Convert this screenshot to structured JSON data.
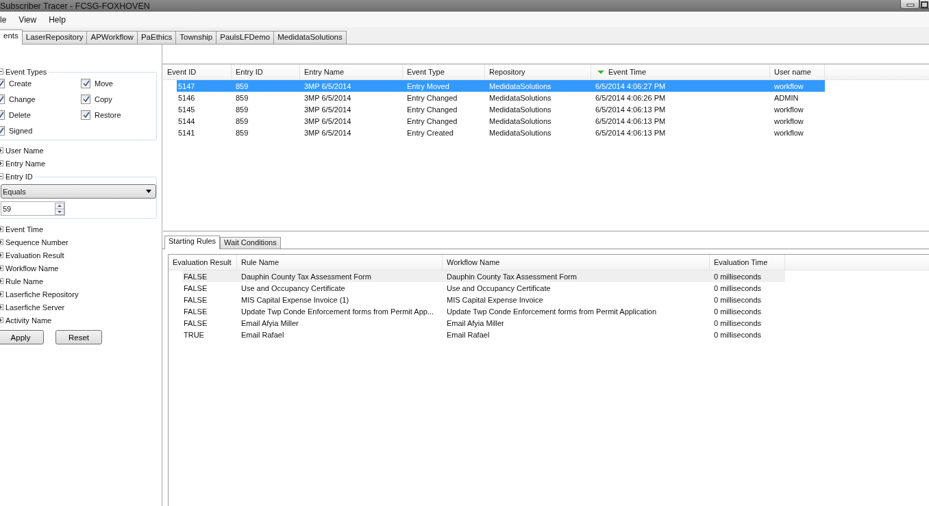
{
  "window": {
    "title": "Subscriber Tracer - FCSG-FOXHOVEN"
  },
  "menu": [
    "le",
    "View",
    "Help"
  ],
  "tabs": [
    {
      "label": "ents",
      "selected": true
    },
    {
      "label": "LaserRepository",
      "selected": false
    },
    {
      "label": "APWorkflow",
      "selected": false
    },
    {
      "label": "PaEthics",
      "selected": false
    },
    {
      "label": "Township",
      "selected": false
    },
    {
      "label": "PaulsLFDemo",
      "selected": false
    },
    {
      "label": "MedidataSolutions",
      "selected": false
    }
  ],
  "filters": [
    {
      "label": "Event Types",
      "expanded": true,
      "kind": "checkboxes",
      "options": [
        {
          "label": "Create",
          "checked": true
        },
        {
          "label": "Move",
          "checked": true
        },
        {
          "label": "Change",
          "checked": true
        },
        {
          "label": "Copy",
          "checked": true
        },
        {
          "label": "Delete",
          "checked": true
        },
        {
          "label": "Restore",
          "checked": true
        },
        {
          "label": "Signed",
          "checked": true
        }
      ]
    },
    {
      "label": "User Name",
      "expanded": false
    },
    {
      "label": "Entry Name",
      "expanded": false
    },
    {
      "label": "Entry ID",
      "expanded": true,
      "kind": "compare",
      "operator": "Equals",
      "value": "59"
    },
    {
      "label": "Event Time",
      "expanded": false
    },
    {
      "label": "Sequence Number",
      "expanded": false
    },
    {
      "label": "Evaluation Result",
      "expanded": false
    },
    {
      "label": "Workflow Name",
      "expanded": false
    },
    {
      "label": "Rule Name",
      "expanded": false
    },
    {
      "label": "Laserfiche Repository",
      "expanded": false
    },
    {
      "label": "Laserfiche Server",
      "expanded": false
    },
    {
      "label": "Activity Name",
      "expanded": false
    }
  ],
  "buttons": [
    "Apply",
    "Reset"
  ],
  "events": {
    "columns": [
      {
        "label": "Event ID",
        "sorted": false
      },
      {
        "label": "Entry ID",
        "sorted": false
      },
      {
        "label": "Entry Name",
        "sorted": false
      },
      {
        "label": "Event Type",
        "sorted": false
      },
      {
        "label": "Repository",
        "sorted": false
      },
      {
        "label": "Event Time",
        "sorted": true
      },
      {
        "label": "User name",
        "sorted": false
      }
    ],
    "rows": [
      {
        "selected": true,
        "cells": [
          "5147",
          "859",
          "3MP 6/5/2014",
          "Entry Moved",
          "MedidataSolutions",
          "6/5/2014 4:06:27 PM",
          "workflow"
        ]
      },
      {
        "selected": false,
        "cells": [
          "5146",
          "859",
          "3MP 6/5/2014",
          "Entry Changed",
          "MedidataSolutions",
          "6/5/2014 4:06:26 PM",
          "ADMIN"
        ]
      },
      {
        "selected": false,
        "cells": [
          "5145",
          "859",
          "3MP 6/5/2014",
          "Entry Changed",
          "MedidataSolutions",
          "6/5/2014 4:06:13 PM",
          "workflow"
        ]
      },
      {
        "selected": false,
        "cells": [
          "5144",
          "859",
          "3MP 6/5/2014",
          "Entry Changed",
          "MedidataSolutions",
          "6/5/2014 4:06:13 PM",
          "workflow"
        ]
      },
      {
        "selected": false,
        "cells": [
          "5141",
          "859",
          "3MP 6/5/2014",
          "Entry Created",
          "MedidataSolutions",
          "6/5/2014 4:06:13 PM",
          "workflow"
        ]
      }
    ]
  },
  "detail_tabs": [
    {
      "label": "Starting Rules",
      "selected": true
    },
    {
      "label": "Wait Conditions",
      "selected": false
    }
  ],
  "rules": {
    "columns": [
      "Evaluation Result",
      "Rule Name",
      "Workflow Name",
      "Evaluation Time"
    ],
    "rows": [
      {
        "selected": true,
        "cells": [
          "FALSE",
          "Dauphin County Tax Assessment Form",
          "Dauphin County Tax Assessment Form",
          "0 milliseconds"
        ]
      },
      {
        "selected": false,
        "cells": [
          "FALSE",
          "Use and Occupancy Certificate",
          "Use and Occupancy Certificate",
          "0 milliseconds"
        ]
      },
      {
        "selected": false,
        "cells": [
          "FALSE",
          "MIS Capital Expense Invoice (1)",
          "MIS Capital Expense Invoice",
          "0 milliseconds"
        ]
      },
      {
        "selected": false,
        "cells": [
          "FALSE",
          "Update Twp Conde Enforcement forms from Permit App...",
          "Update Twp Conde Enforcement forms from Permit Application",
          "0 milliseconds"
        ]
      },
      {
        "selected": false,
        "cells": [
          "FALSE",
          "Email Afyia Miller",
          "Email Afyia Miller",
          "0 milliseconds"
        ]
      },
      {
        "selected": false,
        "cells": [
          "TRUE",
          "Email Rafael",
          "Email Rafael",
          "0 milliseconds"
        ]
      }
    ]
  }
}
